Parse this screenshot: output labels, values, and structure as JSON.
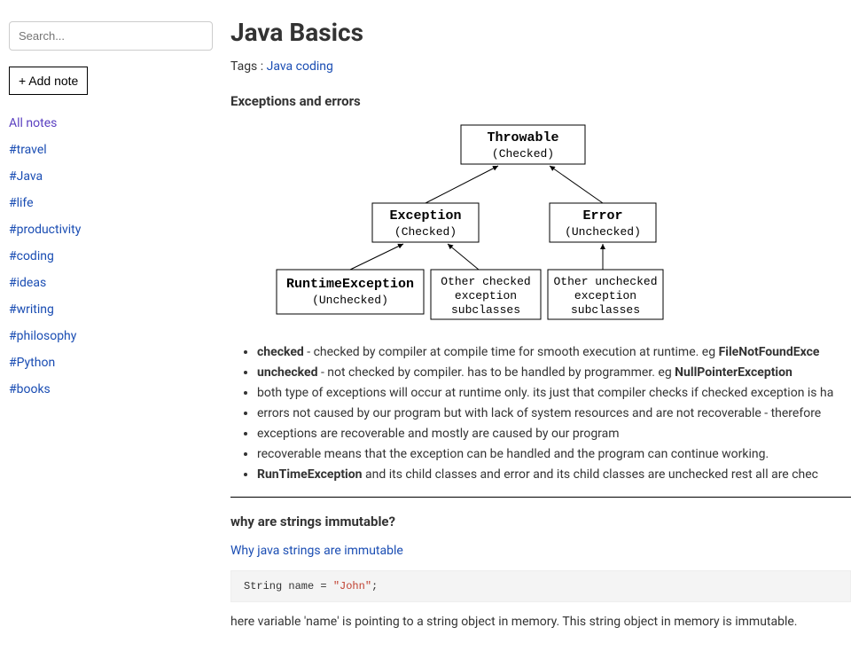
{
  "sidebar": {
    "search_placeholder": "Search...",
    "add_note_label": "+ Add note",
    "all_notes_label": "All notes",
    "tags": [
      "#travel",
      "#Java",
      "#life",
      "#productivity",
      "#coding",
      "#ideas",
      "#writing",
      "#philosophy",
      "#Python",
      "#books"
    ]
  },
  "note": {
    "title": "Java Basics",
    "tags_prefix": "Tags : ",
    "tag_links": [
      "Java",
      "coding"
    ],
    "section1_heading": "Exceptions and errors",
    "diagram": {
      "throwable": "Throwable",
      "throwable_sub": "(Checked)",
      "exception": "Exception",
      "exception_sub": "(Checked)",
      "error": "Error",
      "error_sub": "(Unchecked)",
      "runtime": "RuntimeException",
      "runtime_sub": "(Unchecked)",
      "other_checked_1": "Other checked",
      "other_checked_2": "exception",
      "other_checked_3": "subclasses",
      "other_unchecked_1": "Other unchecked",
      "other_unchecked_2": "exception",
      "other_unchecked_3": "subclasses"
    },
    "bullets": [
      {
        "bold": "checked",
        "rest": " - checked by compiler at compile time for smooth execution at runtime. eg ",
        "tail_bold": "FileNotFoundExce"
      },
      {
        "bold": "unchecked",
        "rest": " - not checked by compiler. has to be handled by programmer. eg ",
        "tail_bold": "NullPointerException"
      },
      {
        "text": "both type of exceptions will occur at runtime only. its just that compiler checks if checked exception is ha"
      },
      {
        "text": "errors not caused by our program but with lack of system resources and are not recoverable - therefore "
      },
      {
        "text": "exceptions are recoverable and mostly are caused by our program"
      },
      {
        "text": "recoverable means that the exception can be handled and the program can continue working."
      },
      {
        "bold": "RunTimeException",
        "rest": " and its child classes and error and its child classes are unchecked rest all are chec"
      }
    ],
    "section2_heading": "why are strings immutable?",
    "section2_link": "Why java strings are immutable",
    "code_line_prefix": "String name = ",
    "code_line_string": "\"John\"",
    "code_line_suffix": ";",
    "section2_para": "here variable 'name' is pointing to a string object in memory. This string object in memory is immutable."
  }
}
